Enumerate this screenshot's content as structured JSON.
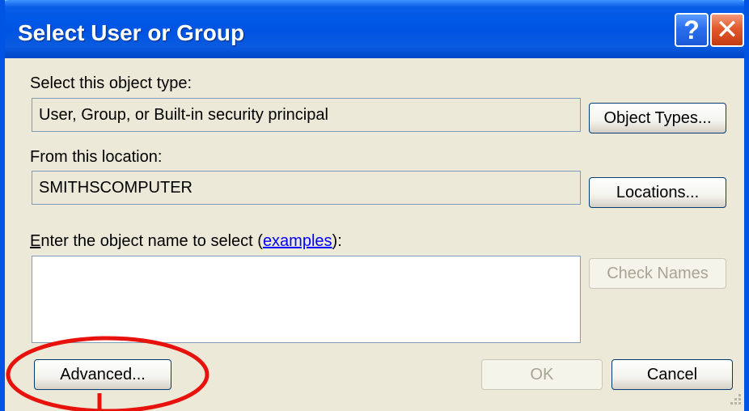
{
  "dialog": {
    "title": "Select User or Group",
    "help_icon": "help-question-icon",
    "close_icon": "close-x-icon"
  },
  "object_type": {
    "label": "Select this object type:",
    "value": "User, Group, or Built-in security principal",
    "button": "Object Types..."
  },
  "location": {
    "label": "From this location:",
    "value": "SMITHSCOMPUTER",
    "button": "Locations..."
  },
  "object_name": {
    "label_access_key": "E",
    "label_text": "nter the object name to select (",
    "examples_link": "examples",
    "label_end": "):",
    "value": "",
    "check_names_button": "Check Names"
  },
  "footer": {
    "advanced_button": "Advanced...",
    "ok_button": "OK",
    "cancel_button": "Cancel"
  },
  "colors": {
    "titlebar": "#0054e3",
    "dialog_bg": "#ece9d8",
    "annotation": "#e8120c",
    "link": "#0000ff"
  }
}
